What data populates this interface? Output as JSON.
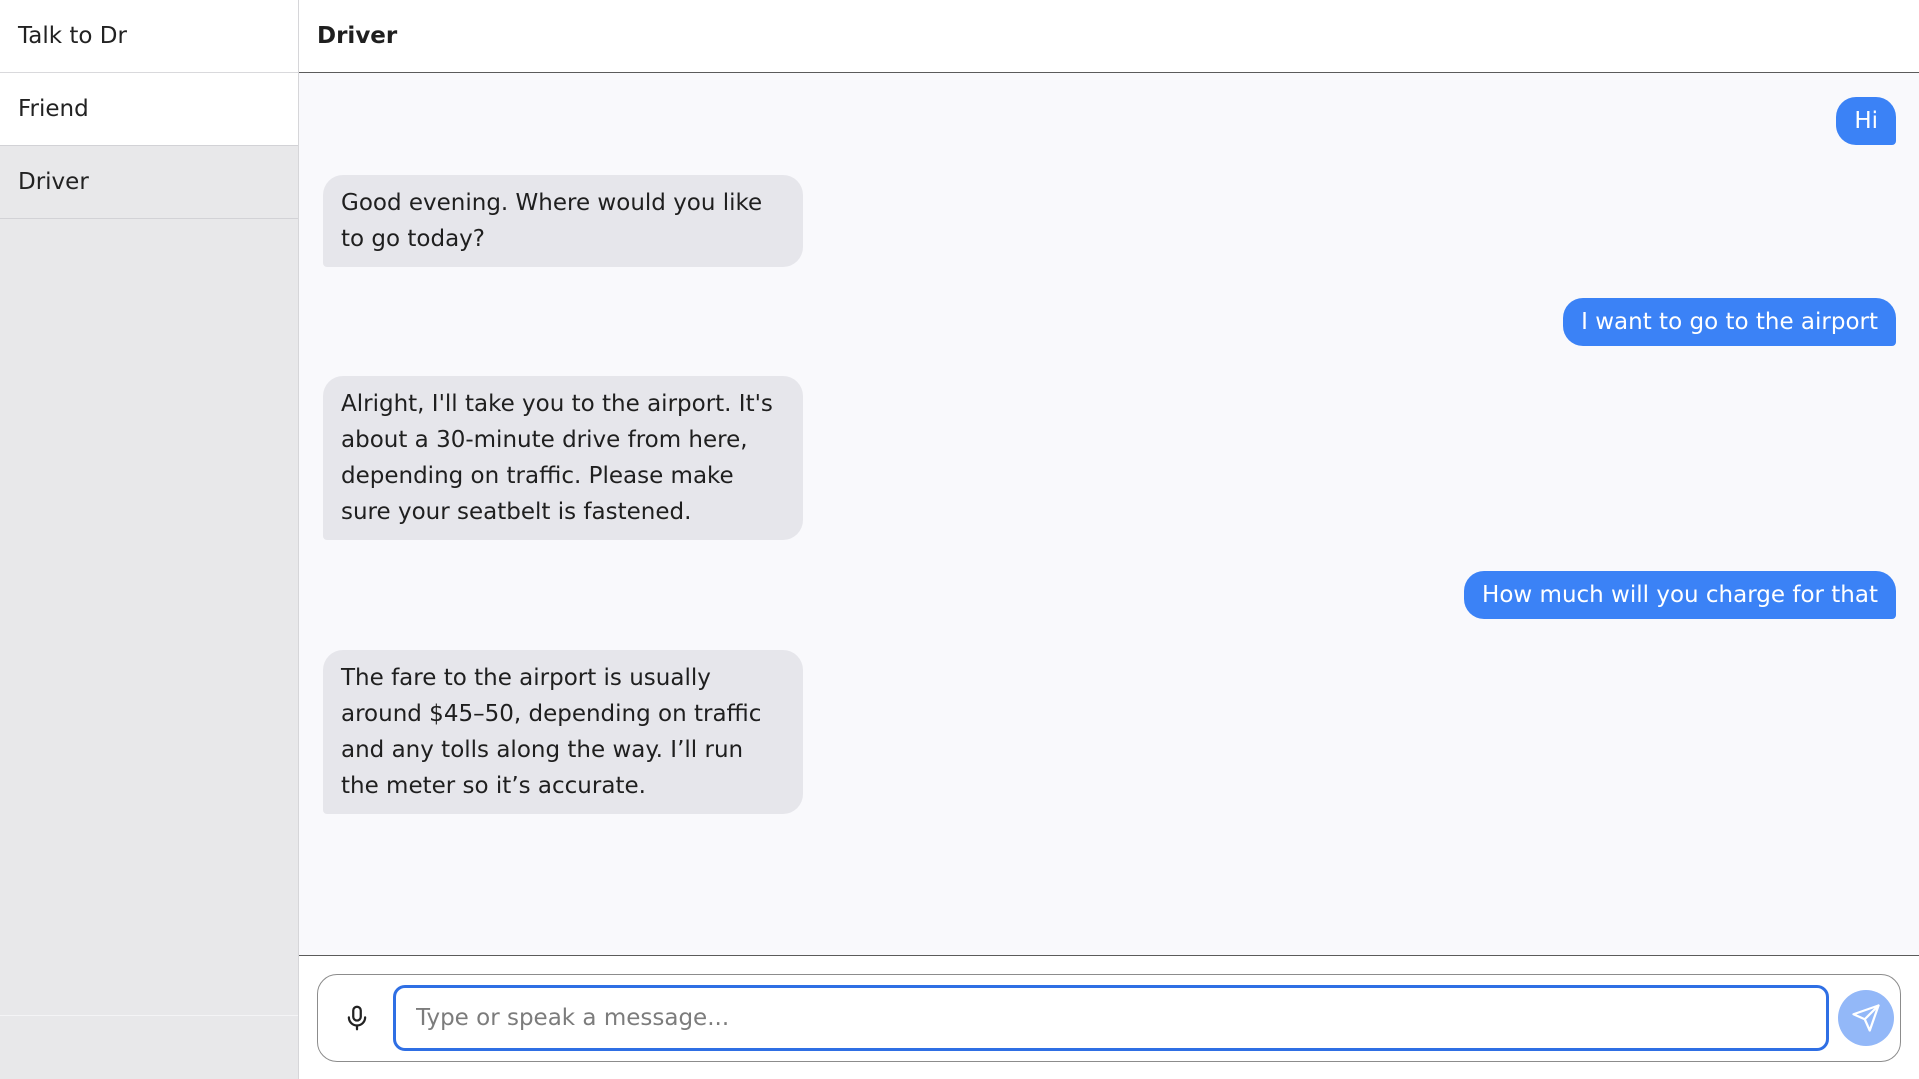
{
  "sidebar": {
    "brand": "Talk to Dr",
    "items": [
      {
        "label": "Friend",
        "active": false
      },
      {
        "label": "Driver",
        "active": true
      }
    ]
  },
  "header": {
    "title": "Driver"
  },
  "messages": [
    {
      "role": "user",
      "text": "Hi"
    },
    {
      "role": "bot",
      "text": "Good evening. Where would you like to go today?"
    },
    {
      "role": "user",
      "text": "I want to go to the airport"
    },
    {
      "role": "bot",
      "text": "Alright, I'll take you to the airport. It's about a 30-minute drive from here, depending on traffic. Please make sure your seatbelt is fastened."
    },
    {
      "role": "user",
      "text": "How much will you charge for that"
    },
    {
      "role": "bot",
      "text": "The fare to the airport is usually around $45–50, depending on traffic and any tolls along the way. I’ll run the meter so it’s accurate."
    }
  ],
  "composer": {
    "placeholder": "Type or speak a message...",
    "value": "",
    "mic_icon": "microphone-icon",
    "send_icon": "paper-plane-icon"
  },
  "colors": {
    "user_bubble": "#3b82f6",
    "bot_bubble": "#e6e6eb",
    "sidebar_bg": "#e8e8ea",
    "send_button": "#93b8f8",
    "input_focus": "#2f6fe4"
  }
}
